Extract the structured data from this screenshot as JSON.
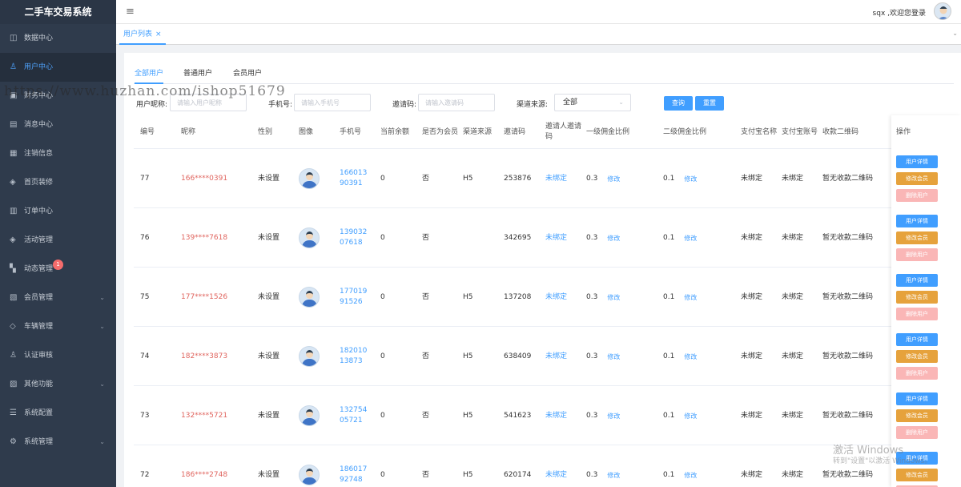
{
  "app": {
    "title": "二手车交易系统"
  },
  "sidebar": {
    "items": [
      {
        "label": "数据中心",
        "icon": "chart-icon",
        "glyph": "◫",
        "active": false,
        "arrow": false
      },
      {
        "label": "用户中心",
        "icon": "user-icon",
        "glyph": "♙",
        "active": true,
        "arrow": false
      },
      {
        "label": "财务中心",
        "icon": "wallet-icon",
        "glyph": "▣",
        "active": false,
        "arrow": false
      },
      {
        "label": "消息中心",
        "icon": "message-icon",
        "glyph": "▤",
        "active": false,
        "arrow": false
      },
      {
        "label": "注销信息",
        "icon": "document-icon",
        "glyph": "▦",
        "active": false,
        "arrow": false
      },
      {
        "label": "首页装修",
        "icon": "box-icon",
        "glyph": "◈",
        "active": false,
        "arrow": false
      },
      {
        "label": "订单中心",
        "icon": "order-icon",
        "glyph": "▥",
        "active": false,
        "arrow": false
      },
      {
        "label": "活动管理",
        "icon": "cube-icon",
        "glyph": "◈",
        "active": false,
        "arrow": false
      },
      {
        "label": "动态管理",
        "icon": "grid-icon",
        "glyph": "▚",
        "active": false,
        "arrow": false,
        "badge": "1"
      },
      {
        "label": "会员管理",
        "icon": "member-icon",
        "glyph": "▧",
        "active": false,
        "arrow": true
      },
      {
        "label": "车辆管理",
        "icon": "layers-icon",
        "glyph": "◇",
        "active": false,
        "arrow": true
      },
      {
        "label": "认证审核",
        "icon": "person-check-icon",
        "glyph": "♙",
        "active": false,
        "arrow": false
      },
      {
        "label": "其他功能",
        "icon": "book-icon",
        "glyph": "▨",
        "active": false,
        "arrow": true
      },
      {
        "label": "系统配置",
        "icon": "list-icon",
        "glyph": "☰",
        "active": false,
        "arrow": false
      },
      {
        "label": "系统管理",
        "icon": "gear-icon",
        "glyph": "⚙",
        "active": false,
        "arrow": true
      }
    ],
    "arrow_glyph": "⌄"
  },
  "header": {
    "menu_glyph": "≡",
    "welcome": "sqx ,欢迎您登录"
  },
  "tabbar": {
    "open_tab": "用户列表",
    "close_glyph": "×",
    "right_glyph": "⌄"
  },
  "tabs": [
    {
      "label": "全部用户",
      "active": true
    },
    {
      "label": "普通用户",
      "active": false
    },
    {
      "label": "会员用户",
      "active": false
    }
  ],
  "filters": {
    "nickname_label": "用户昵称:",
    "nickname_placeholder": "请输入用户昵称",
    "phone_label": "手机号:",
    "phone_placeholder": "请输入手机号",
    "invite_label": "邀请码:",
    "invite_placeholder": "请输入邀请码",
    "channel_label": "渠道来源:",
    "channel_value": "全部",
    "caret_glyph": "⌄",
    "query_button": "查询",
    "reset_button": "重置"
  },
  "table": {
    "headers": [
      "编号",
      "昵称",
      "性别",
      "图像",
      "手机号",
      "当前余额",
      "是否为会员",
      "渠道来源",
      "邀请码",
      "邀请人邀请码",
      "一级佣金比例",
      "二级佣金比例",
      "支付宝名称",
      "支付宝账号",
      "收款二维码",
      "操作"
    ],
    "edit_label": "修改",
    "ops": {
      "detail": "用户详情",
      "member": "修改会员",
      "delete": "删除用户"
    },
    "rows": [
      {
        "id": "77",
        "nickname": "166****0391",
        "gender": "未设置",
        "phone": "16601390391",
        "balance": "0",
        "member": "否",
        "channel": "H5",
        "invite": "253876",
        "inviter": "未绑定",
        "c1": "0.3",
        "c2": "0.1",
        "alipay_name": "未绑定",
        "alipay_account": "未绑定",
        "qrcode": "暂无收款二维码"
      },
      {
        "id": "76",
        "nickname": "139****7618",
        "gender": "未设置",
        "phone": "13903207618",
        "balance": "0",
        "member": "否",
        "channel": "",
        "invite": "342695",
        "inviter": "未绑定",
        "c1": "0.3",
        "c2": "0.1",
        "alipay_name": "未绑定",
        "alipay_account": "未绑定",
        "qrcode": "暂无收款二维码"
      },
      {
        "id": "75",
        "nickname": "177****1526",
        "gender": "未设置",
        "phone": "17701991526",
        "balance": "0",
        "member": "否",
        "channel": "H5",
        "invite": "137208",
        "inviter": "未绑定",
        "c1": "0.3",
        "c2": "0.1",
        "alipay_name": "未绑定",
        "alipay_account": "未绑定",
        "qrcode": "暂无收款二维码"
      },
      {
        "id": "74",
        "nickname": "182****3873",
        "gender": "未设置",
        "phone": "18201013873",
        "balance": "0",
        "member": "否",
        "channel": "H5",
        "invite": "638409",
        "inviter": "未绑定",
        "c1": "0.3",
        "c2": "0.1",
        "alipay_name": "未绑定",
        "alipay_account": "未绑定",
        "qrcode": "暂无收款二维码"
      },
      {
        "id": "73",
        "nickname": "132****5721",
        "gender": "未设置",
        "phone": "13275405721",
        "balance": "0",
        "member": "否",
        "channel": "H5",
        "invite": "541623",
        "inviter": "未绑定",
        "c1": "0.3",
        "c2": "0.1",
        "alipay_name": "未绑定",
        "alipay_account": "未绑定",
        "qrcode": "暂无收款二维码"
      },
      {
        "id": "72",
        "nickname": "186****2748",
        "gender": "未设置",
        "phone": "18601792748",
        "balance": "0",
        "member": "否",
        "channel": "H5",
        "invite": "620174",
        "inviter": "未绑定",
        "c1": "0.3",
        "c2": "0.1",
        "alipay_name": "未绑定",
        "alipay_account": "未绑定",
        "qrcode": "暂无收款二维码"
      }
    ]
  },
  "overlay": {
    "watermark": "https://www.huzhan.com/ishop51679",
    "activate_title": "激活 Windows",
    "activate_sub": "转到\"设置\"以激活 Windows。"
  }
}
